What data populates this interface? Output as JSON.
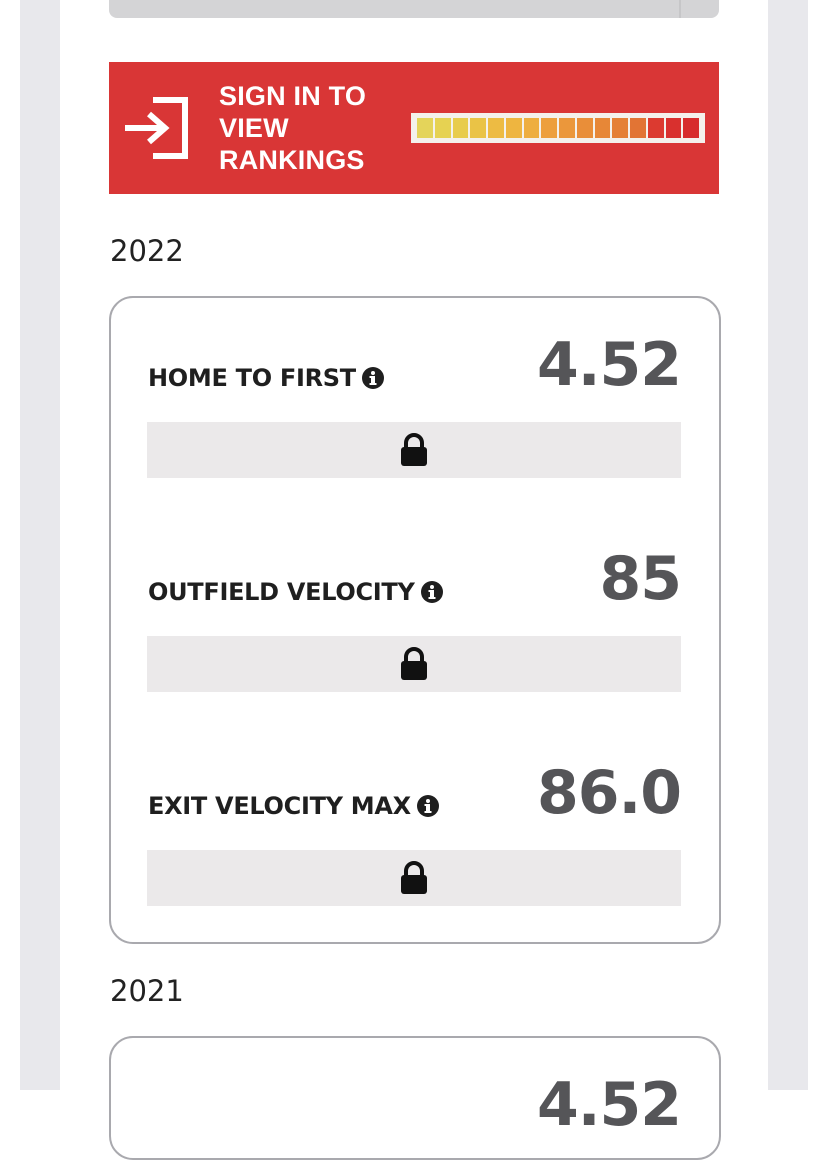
{
  "signin_banner": {
    "text": "SIGN IN TO VIEW RANKINGS",
    "color": "#d93636",
    "icon": "sign-in-icon",
    "rank_scale_colors": [
      "#e4d45a",
      "#e6d252",
      "#e8cc4c",
      "#eac346",
      "#edbb43",
      "#eeb540",
      "#eeae3f",
      "#ed9f3d",
      "#eb973b",
      "#e98e39",
      "#e78737",
      "#e58036",
      "#e27434",
      "#dc3a30",
      "#d9302e",
      "#d72c2c"
    ]
  },
  "sections": [
    {
      "year": "2022",
      "stats": [
        {
          "label": "HOME TO FIRST",
          "value": "4.52"
        },
        {
          "label": "OUTFIELD VELOCITY",
          "value": "85"
        },
        {
          "label": "EXIT VELOCITY MAX",
          "value": "86.0"
        }
      ]
    },
    {
      "year": "2021",
      "stats": [
        {
          "label": "",
          "value": "4.52"
        }
      ]
    }
  ]
}
